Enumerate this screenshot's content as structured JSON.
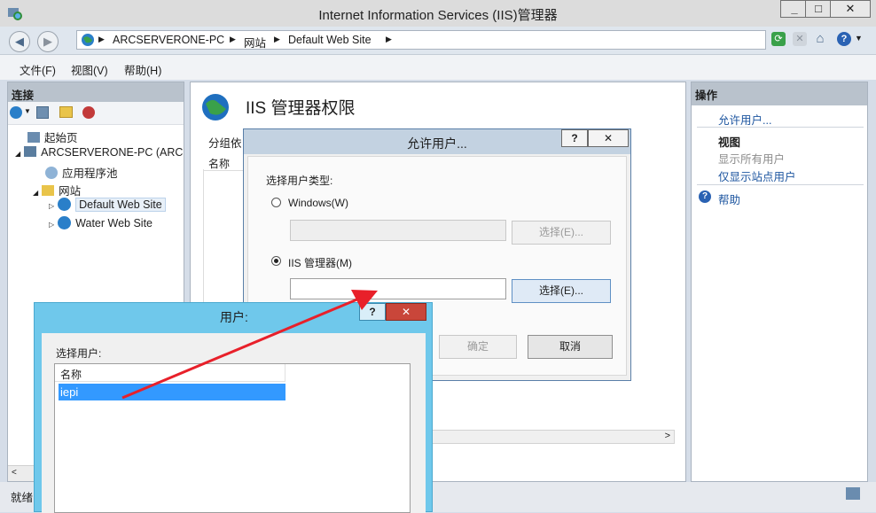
{
  "window": {
    "title": "Internet Information Services (IIS)管理器",
    "controls": [
      "_",
      "□",
      "✕"
    ]
  },
  "nav": {
    "breadcrumb": [
      "ARCSERVERONE-PC",
      "网站",
      "Default Web Site"
    ]
  },
  "menu": [
    "文件(F)",
    "视图(V)",
    "帮助(H)"
  ],
  "left": {
    "header": "连接",
    "tree": [
      {
        "label": "起始页"
      },
      {
        "label": "ARCSERVERONE-PC (ARCS"
      },
      {
        "label": "应用程序池"
      },
      {
        "label": "网站"
      },
      {
        "label": "Default Web Site",
        "selected": true
      },
      {
        "label": "Water Web Site"
      }
    ]
  },
  "center": {
    "title": "IIS 管理器权限",
    "groupby_label": "分组依",
    "column": "名称"
  },
  "right": {
    "header": "操作",
    "allow_user": "允许用户...",
    "view_heading": "视图",
    "show_all": "显示所有用户",
    "show_site": "仅显示站点用户",
    "help": "帮助"
  },
  "status": {
    "text": "就绪"
  },
  "allow_dialog": {
    "title": "允许用户...",
    "help_btn": "?",
    "close_btn": "✕",
    "type_label": "选择用户类型:",
    "windows_option": "Windows(W)",
    "select_disabled": "选择(E)...",
    "iis_option": "IIS 管理器(M)",
    "select_btn": "选择(E)...",
    "ok": "确定",
    "cancel": "取消"
  },
  "users_dialog": {
    "title": "用户:",
    "help_btn": "?",
    "close_btn": "✕",
    "select_label": "选择用户:",
    "column": "名称",
    "rows": [
      "iepi"
    ]
  },
  "colors": {
    "accent_selected": "#3399ff",
    "link": "#1e56a0",
    "arrow": "#e8202a",
    "users_dialog_frame": "#6fc8eb"
  }
}
